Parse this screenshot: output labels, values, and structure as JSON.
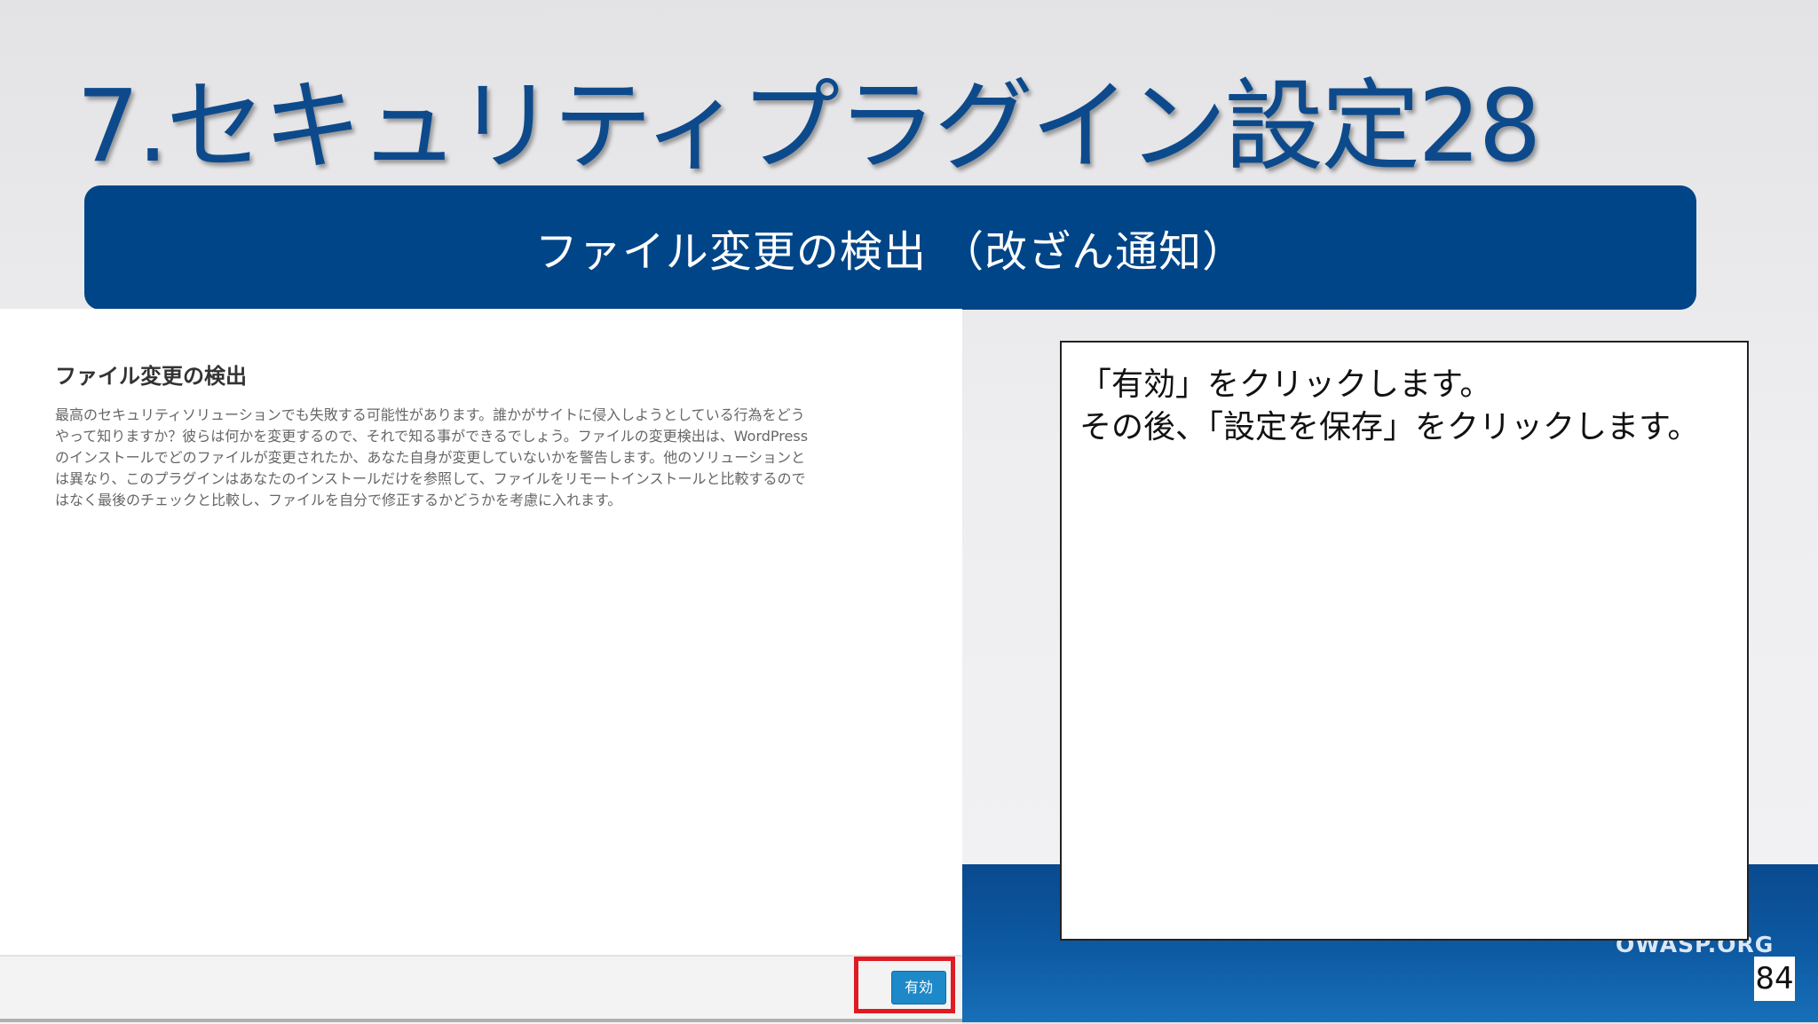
{
  "slide": {
    "title": "7.セキュリティプラグイン設定28",
    "banner": "ファイル変更の検出 （改ざん通知）",
    "footer_url": "OWASP.ORG",
    "page_number": "84"
  },
  "plugin_panel": {
    "heading": "ファイル変更の検出",
    "description_lines": [
      "最高のセキュリティソリューションでも失敗する可能性があります。誰かがサイトに侵入しようとしている行為をどう",
      "やって知りますか？彼らは何かを変更するので、それで知る事ができるでしょう。ファイルの変更検出は、WordPress",
      "のインストールでどのファイルが変更されたか、あなた自身が変更していないかを警告します。他のソリューションと",
      "は異なり、このプラグインはあなたのインストールだけを参照して、ファイルをリモートインストールと比較するので",
      "はなく最後のチェックと比較し、ファイルを自分で修正するかどうかを考慮に入れます。"
    ],
    "enable_button": "有効"
  },
  "callout": {
    "lines": [
      "「有効」をクリックします。",
      "その後、「設定を保存」をクリックします。"
    ]
  },
  "colors": {
    "title": "#0d4a8c",
    "banner": "#004587",
    "button": "#1d89c8",
    "highlight": "#e01a22"
  }
}
